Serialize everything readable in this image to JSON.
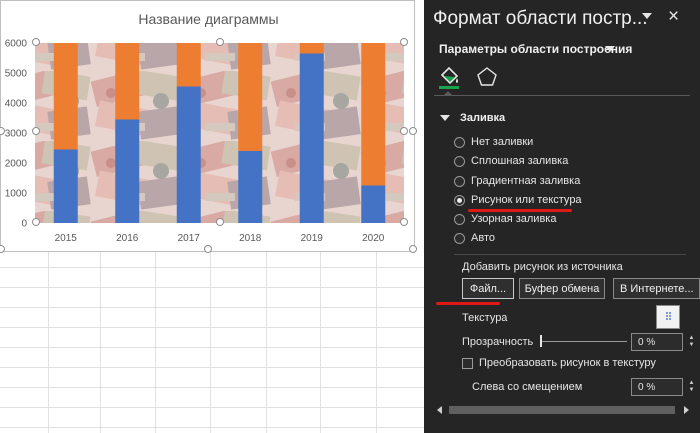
{
  "chart_data": {
    "type": "bar",
    "stacked": true,
    "title": "Название диаграммы",
    "categories": [
      "2015",
      "2016",
      "2017",
      "2018",
      "2019",
      "2020"
    ],
    "series": [
      {
        "values": [
          2450,
          3450,
          4550,
          2400,
          5650,
          1250
        ],
        "color": "#4472c4"
      },
      {
        "values": [
          3550,
          2550,
          1450,
          3600,
          350,
          4750
        ],
        "color": "#ed7d31"
      }
    ],
    "ylim": [
      0,
      6000
    ],
    "yticks": [
      "0",
      "1000",
      "2000",
      "3000",
      "4000",
      "5000",
      "6000"
    ],
    "grid": false,
    "legend": "none",
    "plot_background": "picture-of-banknotes"
  },
  "pane": {
    "title": "Формат области постр...",
    "close_icon": "×",
    "subtitle": "Параметры области построения",
    "tabs": [
      {
        "icon": "paint-bucket-icon",
        "active": true
      },
      {
        "icon": "pentagon-icon",
        "active": false
      }
    ],
    "fill_section": "Заливка",
    "fill_options": [
      {
        "label": "Нет заливки",
        "selected": false
      },
      {
        "label": "Сплошная заливка",
        "selected": false
      },
      {
        "label": "Градиентная заливка",
        "selected": false
      },
      {
        "label": "Рисунок или текстура",
        "selected": true
      },
      {
        "label": "Узорная заливка",
        "selected": false
      },
      {
        "label": "Авто",
        "selected": false
      }
    ],
    "add_picture_label": "Добавить рисунок из источника",
    "file_button": "Файл...",
    "clipboard_button": "Буфер обмена",
    "online_button": "В Интернете...",
    "texture_label": "Текстура",
    "transparency_label": "Прозрачность",
    "transparency_value": "0 %",
    "transparency_level": 0,
    "tile_label": "Преобразовать рисунок в текстуру",
    "offset_left_label": "Слева со смещением",
    "offset_left_value": "0 %",
    "accent_color": "#e01818"
  }
}
